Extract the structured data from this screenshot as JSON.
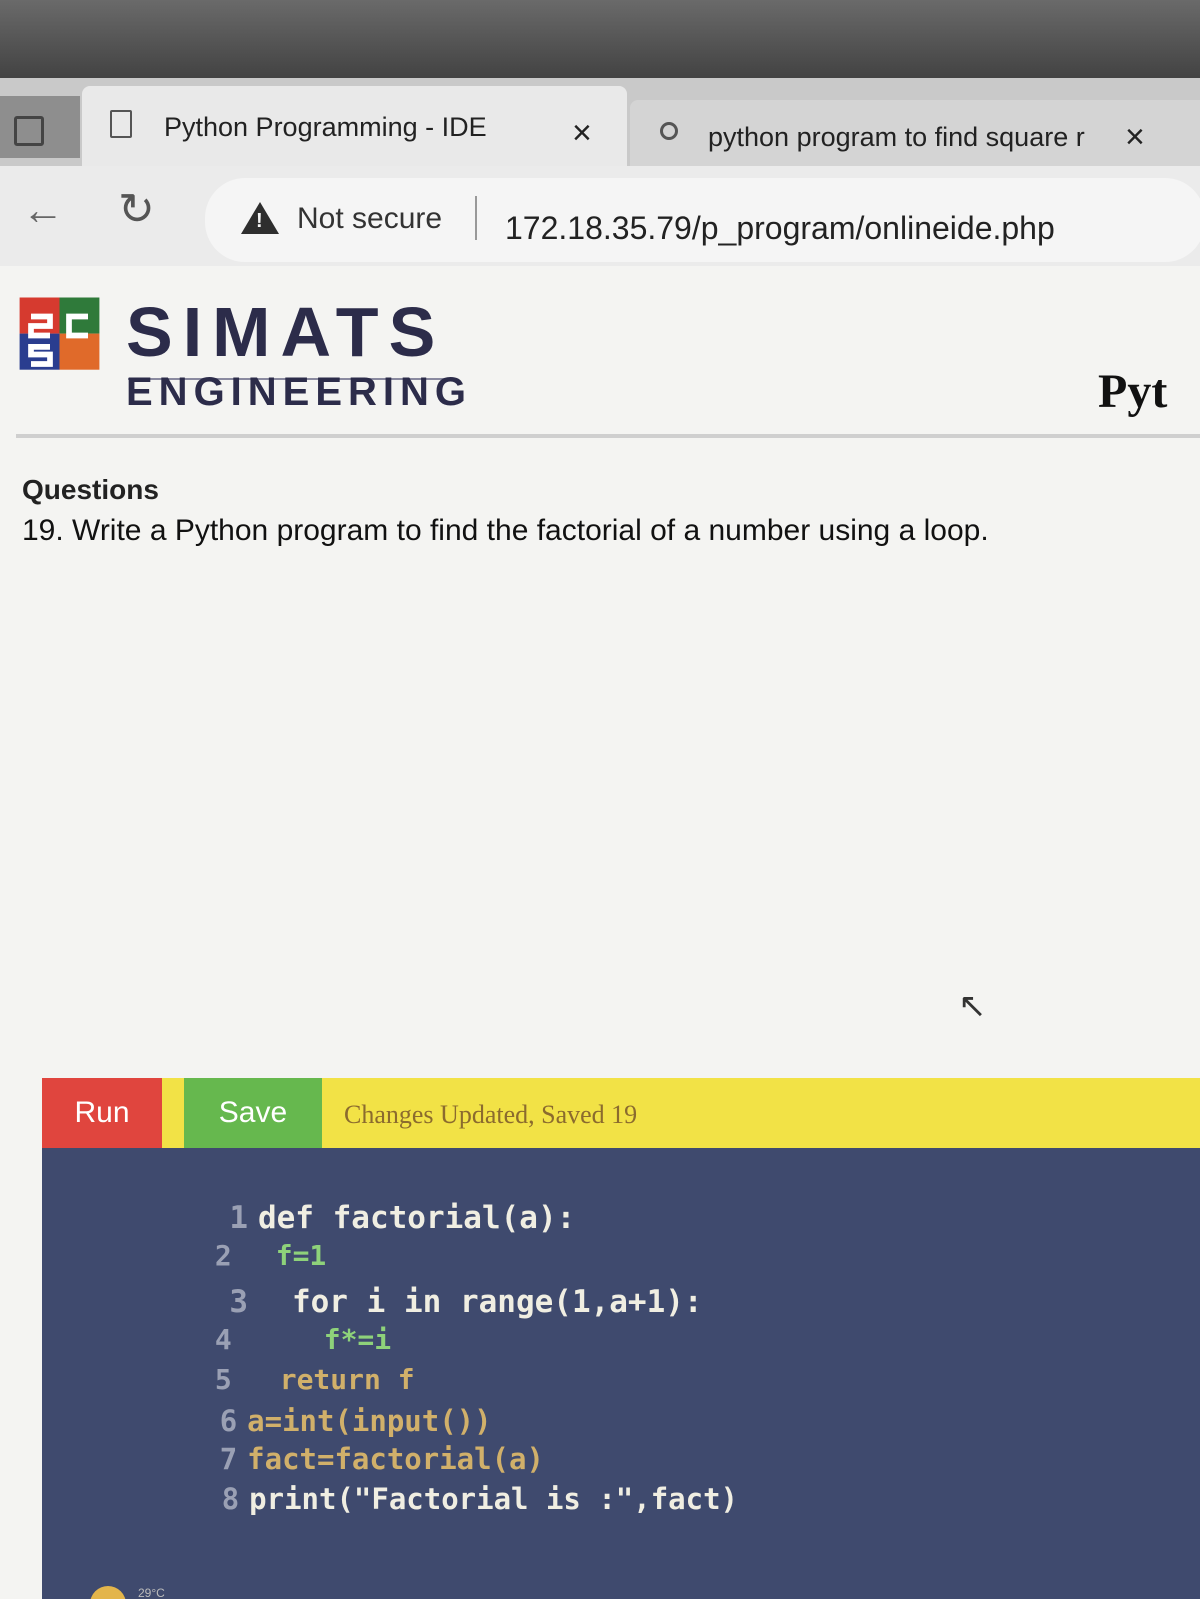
{
  "browser": {
    "tabs": [
      {
        "title": "Python Programming - IDE",
        "close": "×"
      },
      {
        "title": "python program to find square r",
        "close": "×"
      }
    ],
    "security_label": "Not secure",
    "url": "172.18.35.79/p_program/onlineide.php"
  },
  "site": {
    "brand_top": "SIMATS",
    "brand_bottom": "ENGINEERING",
    "header_right": "Pyt"
  },
  "question": {
    "heading": "Questions",
    "text": "19. Write a Python program to find the factorial of a number using a loop."
  },
  "editor_toolbar": {
    "run_label": "Run",
    "save_label": "Save",
    "status": "Changes Updated, Saved 19"
  },
  "code": {
    "line_numbers": [
      "1",
      "2",
      "3",
      "4",
      "5",
      "6",
      "7",
      "8"
    ],
    "lines": [
      "def factorial(a):",
      "f=1",
      "for i in range(1,a+1):",
      "f*=i",
      "return f",
      "a=int(input())",
      "fact=factorial(a)",
      "print(\"Factorial is :\",fact)"
    ]
  },
  "taskbar": {
    "temperature": "29°C"
  },
  "colors": {
    "run": "#e0453e",
    "save": "#66b84e",
    "toolbar": "#f2e246",
    "editor_bg": "#3f4a6e"
  }
}
